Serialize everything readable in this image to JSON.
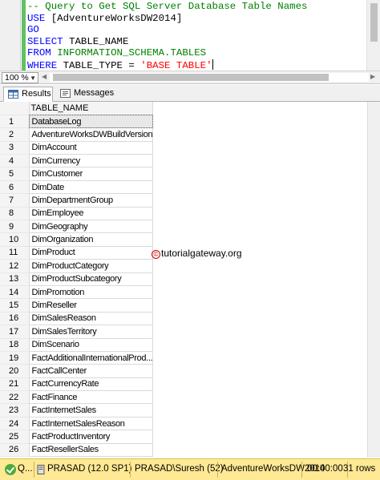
{
  "editor": {
    "lines": [
      "-- Query to Get SQL Server Database Table Names",
      "USE [AdventureWorksDW2014]",
      "GO",
      "SELECT TABLE_NAME",
      "FROM INFORMATION_SCHEMA.TABLES",
      "WHERE TABLE_TYPE = 'BASE TABLE'"
    ],
    "tokens": {
      "comment": "-- Query to Get SQL Server Database Table Names",
      "use": "USE",
      "db": "[AdventureWorksDW2014]",
      "go": "GO",
      "select": "SELECT",
      "col": "TABLE_NAME",
      "from": "FROM",
      "schema": "INFORMATION_SCHEMA.TABLES",
      "where": "WHERE",
      "wherecol": "TABLE_TYPE",
      "eq": "=",
      "value": "'BASE TABLE'"
    }
  },
  "zoom": {
    "value": "100 %"
  },
  "tabs": [
    {
      "label": "Results",
      "icon": "grid-icon"
    },
    {
      "label": "Messages",
      "icon": "messages-icon"
    }
  ],
  "grid": {
    "column": "TABLE_NAME",
    "rows": [
      "DatabaseLog",
      "AdventureWorksDWBuildVersion",
      "DimAccount",
      "DimCurrency",
      "DimCustomer",
      "DimDate",
      "DimDepartmentGroup",
      "DimEmployee",
      "DimGeography",
      "DimOrganization",
      "DimProduct",
      "DimProductCategory",
      "DimProductSubcategory",
      "DimPromotion",
      "DimReseller",
      "DimSalesReason",
      "DimSalesTerritory",
      "DimScenario",
      "FactAdditionalInternationalProd...",
      "FactCallCenter",
      "FactCurrencyRate",
      "FactFinance",
      "FactInternetSales",
      "FactInternetSalesReason",
      "FactProductInventory",
      "FactResellerSales"
    ]
  },
  "watermark": {
    "symbol": "©",
    "text": "tutorialgateway.org"
  },
  "status": {
    "state": "Q...",
    "server": "PRASAD (12.0 SP1)",
    "user": "PRASAD\\Suresh (52)",
    "database": "AdventureWorksDW2014",
    "time": "00:00:00",
    "rows": "31 rows"
  },
  "colors": {
    "status_bg": "#ffe995",
    "keyword": "#0000ff",
    "comment": "#008000",
    "string": "#ff0000"
  }
}
